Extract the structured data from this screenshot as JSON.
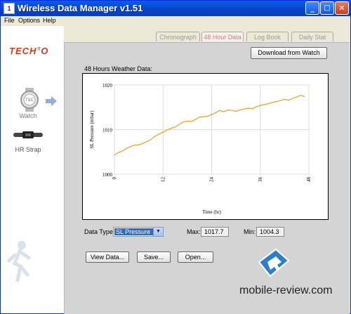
{
  "window": {
    "title": "Wireless Data Manager v1.51",
    "app_icon": "app-icon"
  },
  "titlebar_buttons": {
    "minimize": "_",
    "maximize": "□",
    "close": "✕"
  },
  "menu": [
    "File",
    "Options",
    "Help"
  ],
  "sidebar": {
    "logo": "TECH",
    "logo_o": "O",
    "logo_mark": "ℛ",
    "watch_label": "Watch",
    "strap_label": "HR Strap"
  },
  "tabs": [
    {
      "label": "Chronograph",
      "active": false
    },
    {
      "label": "48 Hour Data",
      "active": true
    },
    {
      "label": "Log Book",
      "active": false
    },
    {
      "label": "Daily Stat",
      "active": false
    }
  ],
  "download_button": "Download from Watch",
  "chart_heading": "48 Hours Weather Data:",
  "controls": {
    "data_type_label": "Data Type:",
    "data_type_value": "SL Pressure",
    "max_label": "Max:",
    "max_value": "1017.7",
    "min_label": "Min:",
    "min_value": "1004.3",
    "view_button": "View Data...",
    "save_button": "Save...",
    "open_button": "Open..."
  },
  "watermark": "mobile-review.com",
  "chart_data": {
    "type": "line",
    "title": "",
    "xlabel": "Time (hr)",
    "ylabel": "SL Pressure (mbar)",
    "xlim": [
      0,
      48
    ],
    "ylim": [
      1000,
      1020
    ],
    "x_ticks": [
      "0",
      "12",
      "24",
      "36",
      "48"
    ],
    "y_ticks": [
      "1000",
      "1010",
      "1020"
    ],
    "grid": true,
    "line_color": "#e8a020",
    "series": [
      {
        "x": [
          0,
          1,
          2,
          3,
          4,
          5,
          6,
          7,
          8,
          9,
          10,
          11,
          12,
          13,
          14,
          15,
          16,
          17,
          18,
          19,
          20,
          21,
          22,
          23,
          24,
          25,
          26,
          27,
          28,
          29,
          30,
          31,
          32,
          33,
          34,
          35,
          36,
          37,
          38,
          39,
          40,
          41,
          42,
          43,
          44,
          45,
          46,
          47
        ],
        "values": [
          1004.3,
          1004.9,
          1005.2,
          1005.8,
          1006.2,
          1006.5,
          1006.6,
          1006.9,
          1007.3,
          1007.8,
          1008.5,
          1009.0,
          1009.4,
          1009.9,
          1010.3,
          1010.6,
          1011.2,
          1011.7,
          1011.9,
          1011.8,
          1012.3,
          1012.8,
          1012.9,
          1013.0,
          1013.4,
          1013.8,
          1014.3,
          1014.0,
          1014.4,
          1014.3,
          1014.1,
          1014.4,
          1014.6,
          1014.8,
          1014.7,
          1015.1,
          1015.4,
          1015.6,
          1015.8,
          1016.1,
          1016.3,
          1016.5,
          1016.8,
          1016.6,
          1017.0,
          1017.3,
          1017.7,
          1017.4
        ]
      }
    ]
  }
}
